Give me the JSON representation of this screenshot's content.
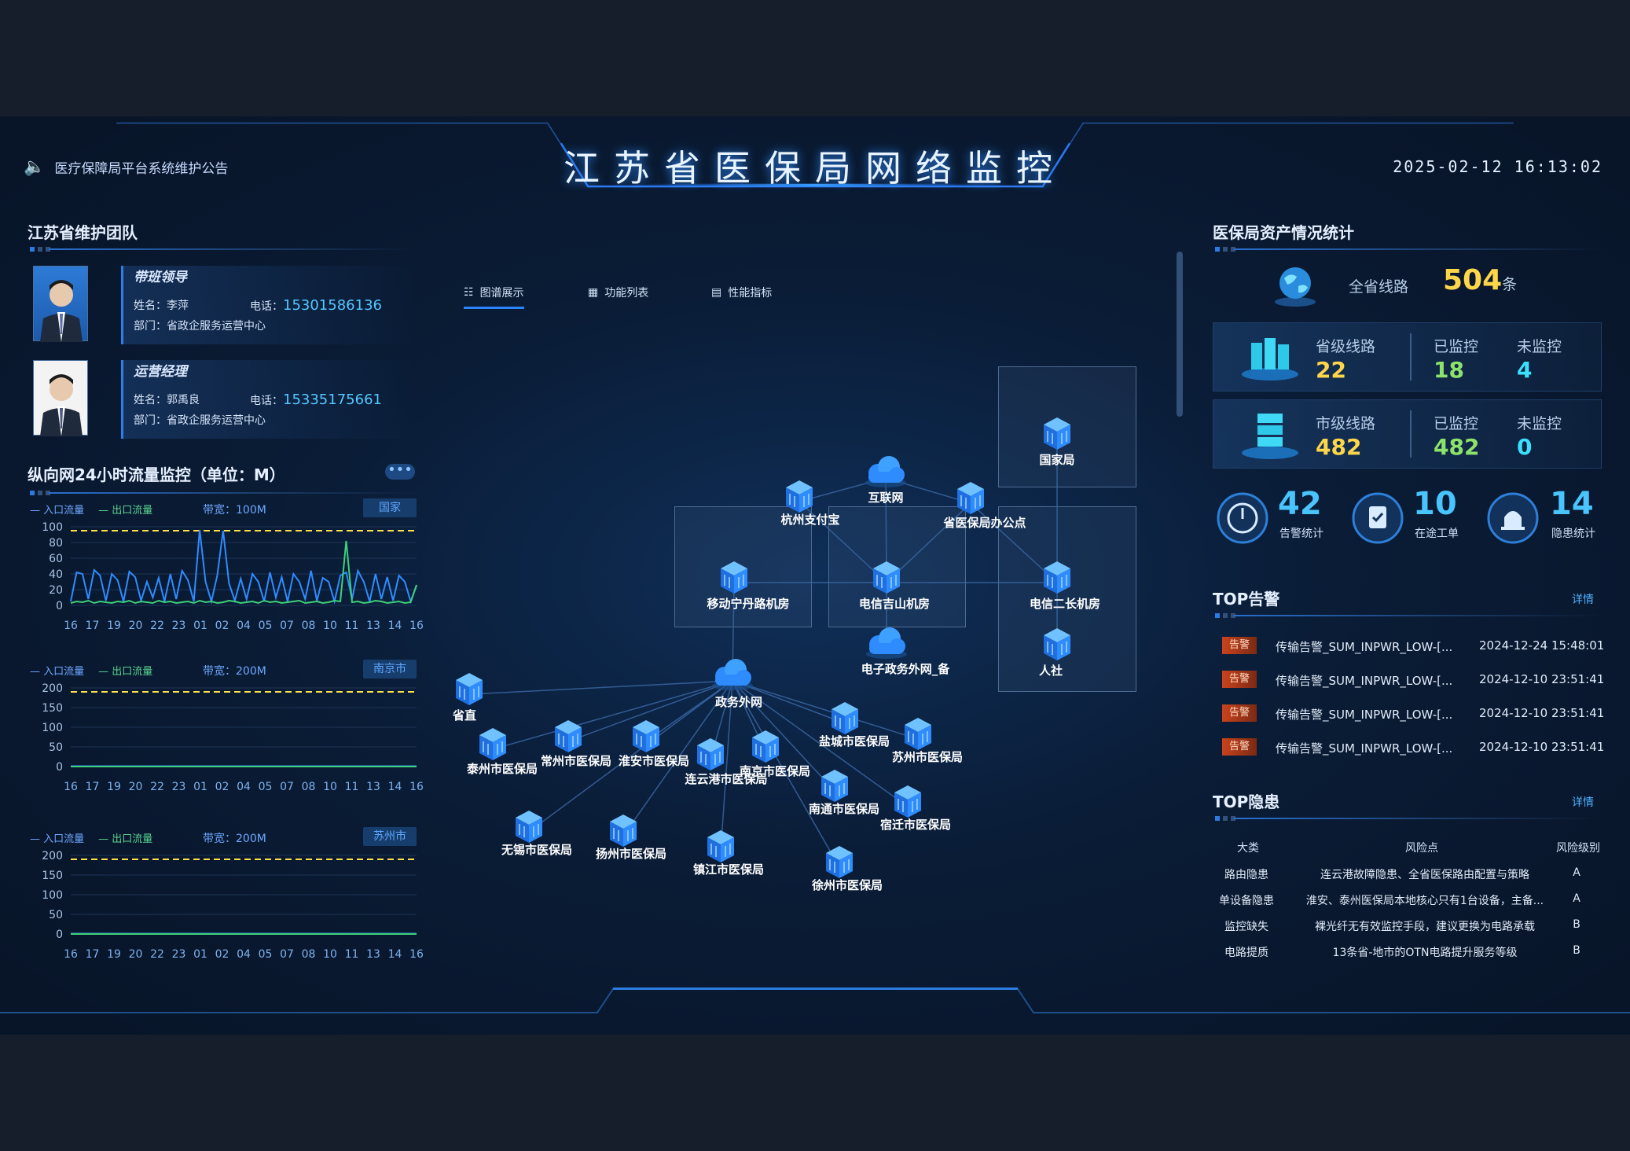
{
  "header": {
    "title": "江苏省医保局网络监控",
    "notice": "医疗保障局平台系统维护公告",
    "datetime": "2025-02-12 16:13:02"
  },
  "team": {
    "title": "江苏省维护团队",
    "members": [
      {
        "role": "带班领导",
        "name_label": "姓名：",
        "name": "李萍",
        "phone_label": "电话：",
        "phone": "15301586136",
        "dept_label": "部门：",
        "dept": "省政企服务运营中心"
      },
      {
        "role": "运营经理",
        "name_label": "姓名：",
        "name": "郭禹良",
        "phone_label": "电话：",
        "phone": "15335175661",
        "dept_label": "部门：",
        "dept": "省政企服务运营中心"
      }
    ]
  },
  "traffic": {
    "title": "纵向网24小时流量监控（单位：M）",
    "legend_in": "入口流量",
    "legend_out": "出口流量",
    "hours": [
      "16",
      "17",
      "19",
      "20",
      "22",
      "23",
      "01",
      "02",
      "04",
      "05",
      "07",
      "08",
      "10",
      "11",
      "13",
      "14",
      "16"
    ],
    "charts": [
      {
        "bandwidth": "带宽：100M",
        "region": "国家",
        "yticks": [
          "100",
          "80",
          "60",
          "40",
          "20",
          "0"
        ],
        "ymax": 100,
        "threshold": 95,
        "inflow": [
          5,
          42,
          40,
          8,
          45,
          38,
          6,
          40,
          32,
          5,
          43,
          36,
          6,
          30,
          10,
          35,
          5,
          40,
          8,
          44,
          32,
          5,
          96,
          30,
          5,
          38,
          95,
          28,
          6,
          34,
          8,
          40,
          30,
          5,
          42,
          10,
          36,
          5,
          40,
          30,
          8,
          44,
          6,
          35,
          30,
          5,
          38,
          42,
          8,
          44,
          30,
          5,
          40,
          8,
          36,
          6,
          38,
          30,
          5,
          25
        ],
        "outflow": [
          3,
          5,
          4,
          6,
          3,
          5,
          4,
          3,
          5,
          4,
          6,
          3,
          5,
          4,
          3,
          6,
          4,
          5,
          3,
          4,
          5,
          3,
          6,
          4,
          5,
          3,
          4,
          6,
          5,
          3,
          4,
          5,
          3,
          6,
          4,
          5,
          3,
          4,
          5,
          6,
          3,
          4,
          5,
          3,
          4,
          6,
          5,
          82,
          4,
          5,
          3,
          4,
          6,
          5,
          3,
          4,
          5,
          3,
          4,
          26
        ]
      },
      {
        "bandwidth": "带宽：200M",
        "region": "南京市",
        "yticks": [
          "200",
          "150",
          "100",
          "50",
          "0"
        ],
        "ymax": 200,
        "threshold": 190,
        "inflow": [
          1,
          1,
          1,
          1,
          1,
          1,
          1,
          1,
          1,
          1,
          1,
          1,
          1,
          1,
          1,
          1,
          1,
          1,
          1,
          1
        ],
        "outflow": [
          0,
          0,
          0,
          0,
          0,
          0,
          0,
          0,
          0,
          0,
          0,
          0,
          0,
          0,
          0,
          0,
          0,
          0,
          0,
          0
        ]
      },
      {
        "bandwidth": "带宽：200M",
        "region": "苏州市",
        "yticks": [
          "200",
          "150",
          "100",
          "50",
          "0"
        ],
        "ymax": 200,
        "threshold": 190,
        "inflow": [
          1,
          1,
          1,
          1,
          1,
          1,
          1,
          1,
          1,
          1,
          1,
          1,
          1,
          1,
          1,
          1,
          1,
          1,
          1,
          1
        ],
        "outflow": [
          0,
          0,
          0,
          0,
          0,
          0,
          0,
          0,
          0,
          0,
          0,
          0,
          0,
          0,
          0,
          0,
          0,
          0,
          0,
          0
        ]
      }
    ]
  },
  "tabs": [
    {
      "label": "图谱展示",
      "icon": "topology-icon",
      "active": true
    },
    {
      "label": "功能列表",
      "icon": "grid-icon",
      "active": false
    },
    {
      "label": "性能指标",
      "icon": "chart-icon",
      "active": false
    }
  ],
  "topology": {
    "nodes": {
      "guojiaju": "国家局",
      "hulianwang": "互联网",
      "hangzhou": "杭州支付宝",
      "shengyibao": "省医保局办公点",
      "yidong": "移动宁丹路机房",
      "dianxin_jishan": "电信吉山机房",
      "dianxin_erchang": "电信二长机房",
      "dianzi": "电子政务外网_备",
      "renshe": "人社",
      "zhengwu": "政务外网",
      "shengzhi": "省直",
      "taizhou": "泰州市医保局",
      "changzhou": "常州市医保局",
      "huaian": "淮安市医保局",
      "lianyungang": "连云港市医保局",
      "nanjing": "南京市医保局",
      "yancheng": "盐城市医保局",
      "suzhou": "苏州市医保局",
      "nantong": "南通市医保局",
      "suqian": "宿迁市医保局",
      "wuxi": "无锡市医保局",
      "yangzhou": "扬州市医保局",
      "zhenjiang": "镇江市医保局",
      "xuzhou": "徐州市医保局"
    }
  },
  "assets": {
    "title": "医保局资产情况统计",
    "total_label": "全省线路",
    "total_value": "504",
    "total_unit": "条",
    "provincial": {
      "label": "省级线路",
      "value": "22",
      "monitored_label": "已监控",
      "monitored": "18",
      "unmonitored_label": "未监控",
      "unmonitored": "4"
    },
    "city": {
      "label": "市级线路",
      "value": "482",
      "monitored_label": "已监控",
      "monitored": "482",
      "unmonitored_label": "未监控",
      "unmonitored": "0"
    },
    "counters": [
      {
        "value": "42",
        "label": "告警统计",
        "icon": "power-icon"
      },
      {
        "value": "10",
        "label": "在途工单",
        "icon": "clipboard-icon"
      },
      {
        "value": "14",
        "label": "隐患统计",
        "icon": "alarm-light-icon"
      }
    ]
  },
  "top_alarms": {
    "title": "TOP告警",
    "detail": "详情",
    "items": [
      {
        "tag": "告警",
        "text": "传输告警_SUM_INPWR_LOW-[...",
        "time": "2024-12-24 15:48:01"
      },
      {
        "tag": "告警",
        "text": "传输告警_SUM_INPWR_LOW-[...",
        "time": "2024-12-10 23:51:41"
      },
      {
        "tag": "告警",
        "text": "传输告警_SUM_INPWR_LOW-[...",
        "time": "2024-12-10 23:51:41"
      },
      {
        "tag": "告警",
        "text": "传输告警_SUM_INPWR_LOW-[...",
        "time": "2024-12-10 23:51:41"
      }
    ]
  },
  "top_risks": {
    "title": "TOP隐患",
    "detail": "详情",
    "headers": [
      "大类",
      "风险点",
      "风险级别"
    ],
    "rows": [
      [
        "路由隐患",
        "连云港故障隐患、全省医保路由配置与策略",
        "A"
      ],
      [
        "单设备隐患",
        "淮安、泰州医保局本地核心只有1台设备，主备...",
        "A"
      ],
      [
        "监控缺失",
        "裸光纤无有效监控手段，建议更换为电路承载",
        "B"
      ],
      [
        "电路提质",
        "13条省-地市的OTN电路提升服务等级",
        "B"
      ]
    ]
  },
  "colors": {
    "accent": "#2a83ff",
    "inflow": "#2e8cff",
    "outflow": "#3fd07a",
    "threshold": "#ffe14a",
    "alarm": "#c9431c"
  }
}
